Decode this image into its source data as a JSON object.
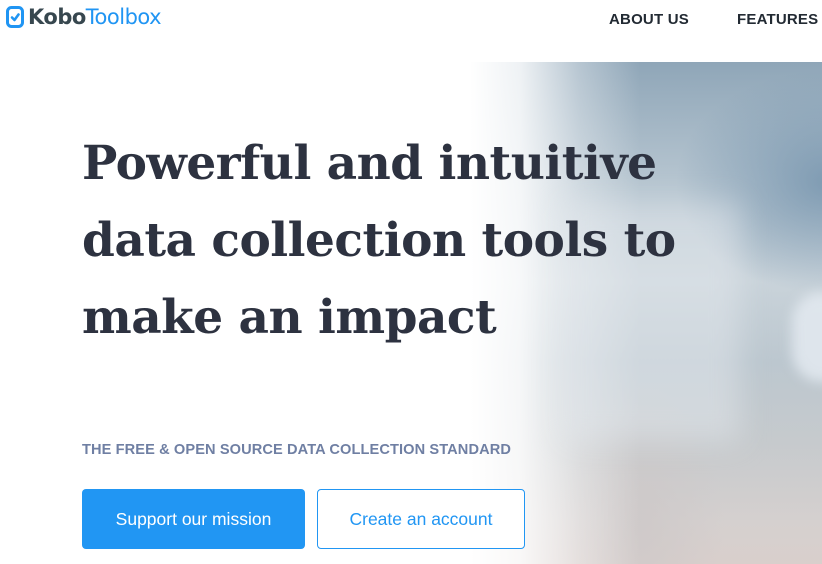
{
  "header": {
    "logo": {
      "kobo": "Kobo",
      "toolbox": "Toolbox",
      "icon": "kobo-logo-mark"
    },
    "nav": {
      "about_label": "ABOUT US",
      "features_label": "FEATURES"
    }
  },
  "hero": {
    "headline": "Powerful and intuitive data collection tools to make an impact",
    "subtitle": "THE FREE & OPEN SOURCE DATA COLLECTION STANDARD",
    "primary_button_label": "Support our mission",
    "secondary_button_label": "Create an account"
  },
  "colors": {
    "brand_blue": "#2196f3",
    "logo_dark": "#37474f",
    "headline": "#2d3240",
    "subtitle": "#6f7fa3"
  }
}
